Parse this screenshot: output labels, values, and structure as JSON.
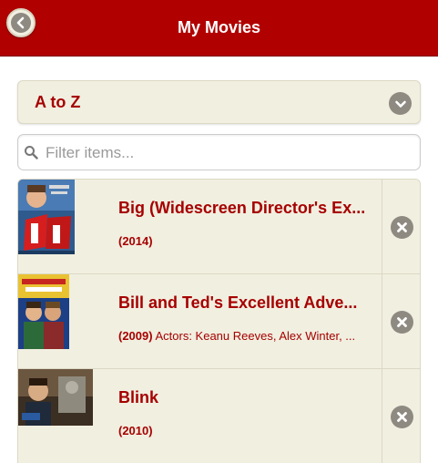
{
  "header": {
    "title": "My Movies",
    "back_icon": "back-arrow-icon",
    "color": "#b10000"
  },
  "sort": {
    "selected": "A to Z",
    "icon": "chevron-down-icon"
  },
  "search": {
    "placeholder": "Filter items...",
    "value": "",
    "icon": "search-icon"
  },
  "movies": [
    {
      "title": "Big (Widescreen Director's Ex...",
      "year": "(2014)",
      "actors": "",
      "thumb_icon": "movie-poster-big",
      "delete_icon": "delete-icon"
    },
    {
      "title": "Bill and Ted's Excellent Adve...",
      "year": "(2009)",
      "actors": " Actors: Keanu Reeves, Alex Winter, ...",
      "thumb_icon": "movie-poster-bill-and-ted",
      "delete_icon": "delete-icon"
    },
    {
      "title": "Blink",
      "year": "(2010)",
      "actors": "",
      "thumb_icon": "movie-poster-blink",
      "delete_icon": "delete-icon"
    }
  ]
}
